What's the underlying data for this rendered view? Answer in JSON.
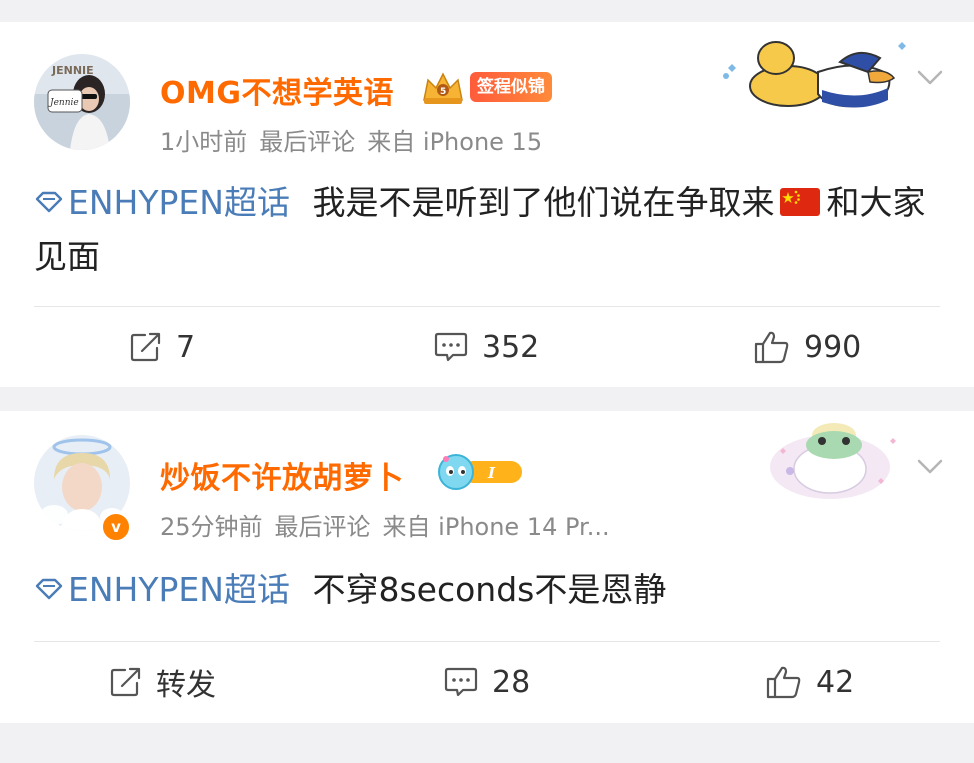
{
  "posts": [
    {
      "username": "OMG不想学英语",
      "badge_text": "签程似锦",
      "meta": {
        "time": "1小时前",
        "status": "最后评论",
        "source": "来自 iPhone 15"
      },
      "topic": "ENHYPEN超话",
      "text_a": "我是不是听到了他们说在争取来",
      "text_b": "和大家见面",
      "flag_icon": "china-flag",
      "actions": {
        "repost": "7",
        "comments": "352",
        "likes": "990"
      }
    },
    {
      "username": "炒饭不许放胡萝卜",
      "meta": {
        "time": "25分钟前",
        "status": "最后评论",
        "source": "来自 iPhone 14 Pr..."
      },
      "topic": "ENHYPEN超话",
      "text_a": "不穿8seconds不是恩静",
      "actions": {
        "repost": "转发",
        "comments": "28",
        "likes": "42"
      }
    }
  ],
  "colors": {
    "username": "#ff6a00",
    "topic": "#4a7cb8",
    "meta": "#8a8a8a",
    "verified": "#ff8200"
  }
}
